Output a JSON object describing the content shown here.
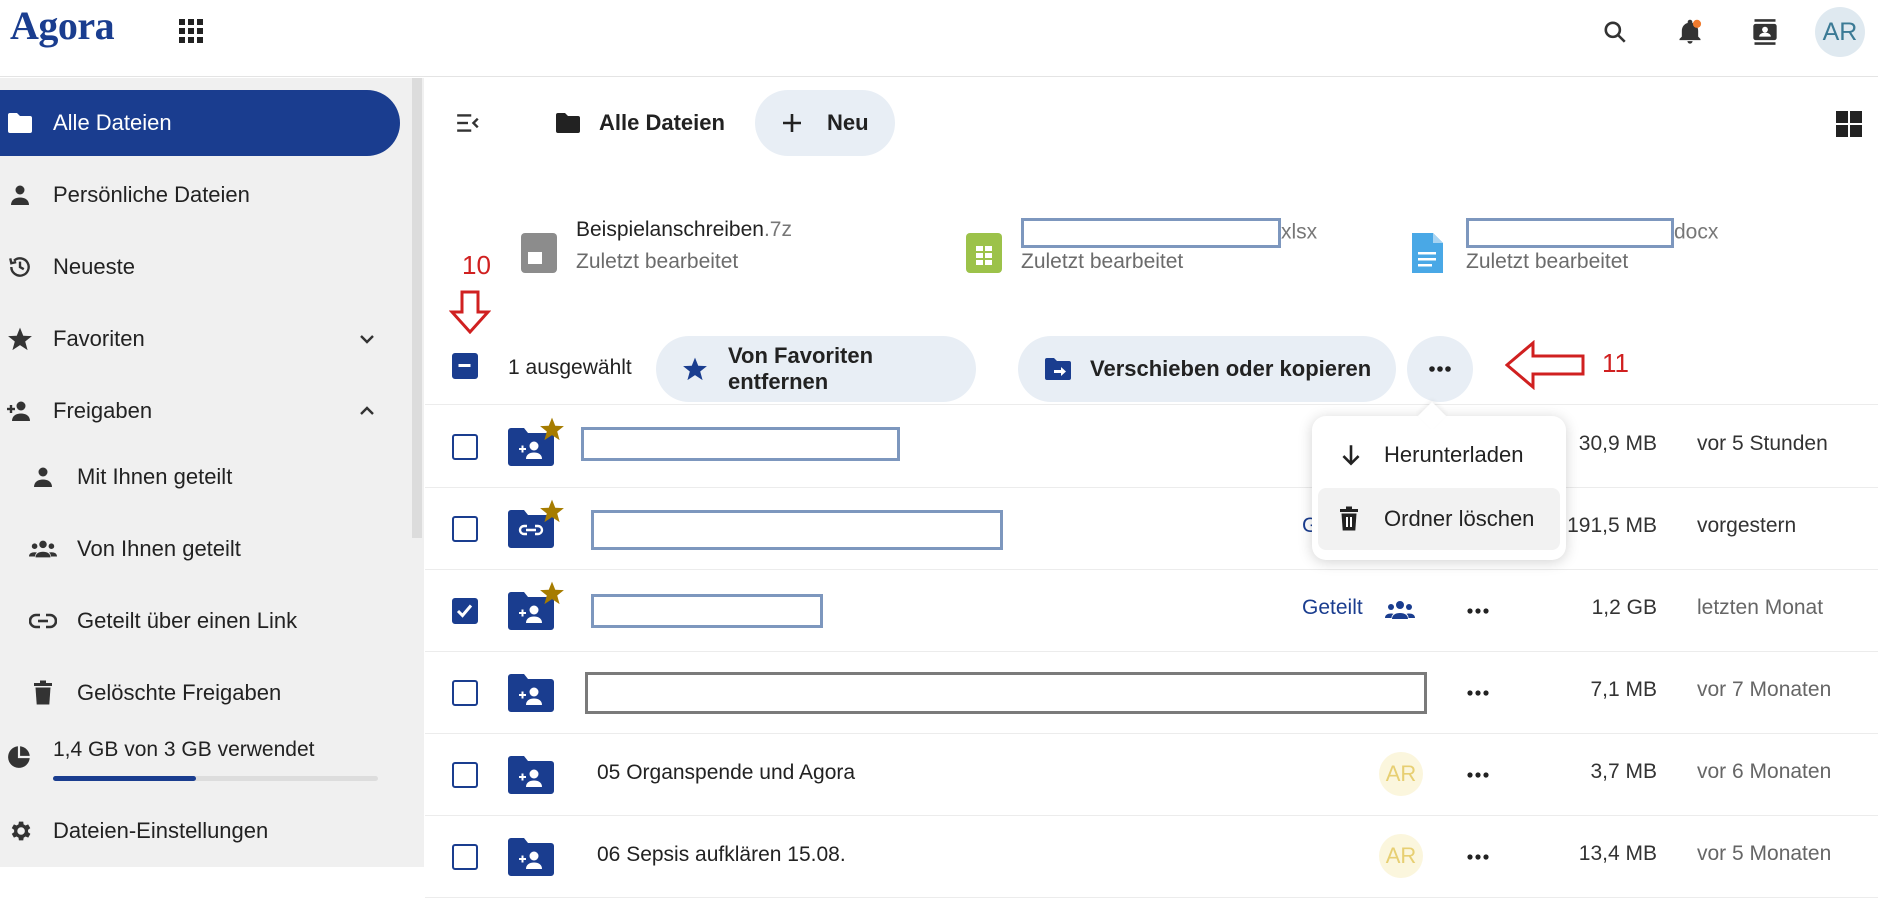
{
  "header": {
    "logo": "Agora",
    "icons": [
      "apps-icon",
      "search-icon",
      "notifications-icon",
      "contacts-icon"
    ],
    "avatar_initials": "AR",
    "accent_color": "#1a3d8f"
  },
  "sidebar": {
    "items": [
      {
        "label": "Alle Dateien",
        "icon": "folder-icon",
        "active": true
      },
      {
        "label": "Persönliche Dateien",
        "icon": "person-icon"
      },
      {
        "label": "Neueste",
        "icon": "history-icon"
      },
      {
        "label": "Favoriten",
        "icon": "star-icon",
        "expand": "chevron-down-icon"
      },
      {
        "label": "Freigaben",
        "icon": "share-person-icon",
        "expand": "chevron-up-icon"
      },
      {
        "label": "Mit Ihnen geteilt",
        "icon": "person-icon"
      },
      {
        "label": "Von Ihnen geteilt",
        "icon": "group-icon"
      },
      {
        "label": "Geteilt über einen Link",
        "icon": "link-icon"
      },
      {
        "label": "Gelöschte Freigaben",
        "icon": "trash-icon"
      }
    ],
    "quota": {
      "text": "1,4 GB von 3 GB verwendet",
      "used_fraction": 0.44
    },
    "settings_label": "Dateien-Einstellungen"
  },
  "main": {
    "breadcrumb": "Alle Dateien",
    "new_button": "Neu",
    "recent": [
      {
        "name": "Beispielanschreiben",
        "ext": ".7z",
        "sub": "Zuletzt bearbeitet"
      },
      {
        "name": "",
        "ext": "xlsx",
        "sub": "Zuletzt bearbeitet"
      },
      {
        "name": "",
        "ext": "docx",
        "sub": "Zuletzt bearbeitet"
      }
    ],
    "selection": {
      "count_text": "1 ausgewählt",
      "unfavorite": "Von Favoriten entfernen",
      "move_copy": "Verschieben oder kopieren"
    },
    "menu": {
      "download": "Herunterladen",
      "delete_folder": "Ordner löschen"
    },
    "rows": [
      {
        "name": "",
        "size": "30,9 MB",
        "date": "vor 5 Stunden",
        "favorite": true
      },
      {
        "name": "",
        "share_partial": "G",
        "size": "191,5 MB",
        "date": "vorgestern",
        "favorite": true
      },
      {
        "name": "",
        "share": "Geteilt",
        "size": "1,2 GB",
        "date": "letzten Monat",
        "favorite": true,
        "checked": true
      },
      {
        "name": "",
        "size": "7,1 MB",
        "date": "vor 7 Monaten"
      },
      {
        "name": "05 Organspende und Agora",
        "avatar": "AR",
        "size": "3,7 MB",
        "date": "vor 6 Monaten"
      },
      {
        "name": "06 Sepsis aufklären 15.08.",
        "avatar": "AR",
        "size": "13,4 MB",
        "date": "vor 5 Monaten"
      }
    ]
  },
  "annotations": {
    "a10": "10",
    "a11": "11"
  }
}
